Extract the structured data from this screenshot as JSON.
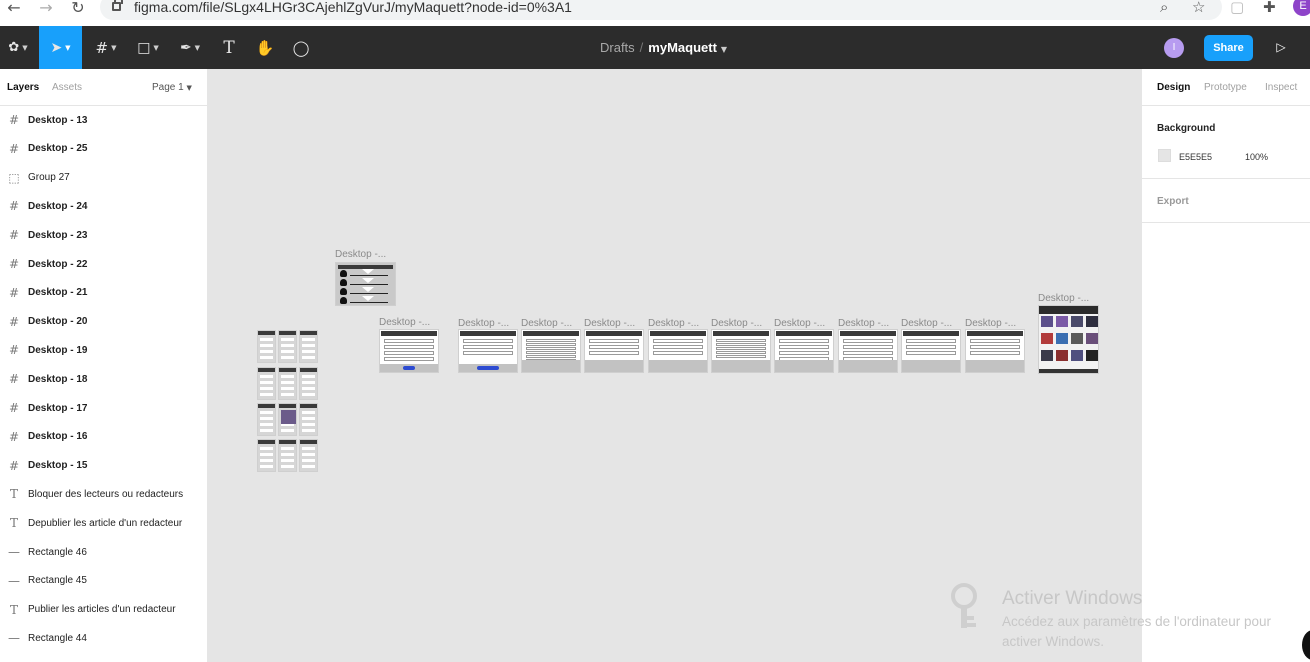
{
  "browser": {
    "url": "figma.com/file/SLgx4LHGr3CAjehlZgVurJ/myMaquett?node-id=0%3A1",
    "profile_initial": "E"
  },
  "toolbar": {
    "breadcrumb_parent": "Drafts",
    "breadcrumb_sep": "/",
    "file_name": "myMaquett",
    "user_initial": "I",
    "share_label": "Share"
  },
  "left_panel": {
    "tab_layers": "Layers",
    "tab_assets": "Assets",
    "page": "Page 1",
    "layers": [
      {
        "name": "Desktop - 13",
        "type": "frame"
      },
      {
        "name": "Desktop - 25",
        "type": "frame"
      },
      {
        "name": "Group 27",
        "type": "group"
      },
      {
        "name": "Desktop - 24",
        "type": "frame"
      },
      {
        "name": "Desktop - 23",
        "type": "frame"
      },
      {
        "name": "Desktop - 22",
        "type": "frame"
      },
      {
        "name": "Desktop - 21",
        "type": "frame"
      },
      {
        "name": "Desktop - 20",
        "type": "frame"
      },
      {
        "name": "Desktop - 19",
        "type": "frame"
      },
      {
        "name": "Desktop - 18",
        "type": "frame"
      },
      {
        "name": "Desktop - 17",
        "type": "frame"
      },
      {
        "name": "Desktop - 16",
        "type": "frame"
      },
      {
        "name": "Desktop - 15",
        "type": "frame"
      },
      {
        "name": "Bloquer des lecteurs ou redacteurs",
        "type": "text"
      },
      {
        "name": "Depublier les article d'un redacteur",
        "type": "text"
      },
      {
        "name": "Rectangle 46",
        "type": "rect"
      },
      {
        "name": "Rectangle 45",
        "type": "rect"
      },
      {
        "name": "Publier les articles d'un redacteur",
        "type": "text"
      },
      {
        "name": "Rectangle 44",
        "type": "rect"
      }
    ]
  },
  "right_panel": {
    "tab_design": "Design",
    "tab_prototype": "Prototype",
    "tab_inspect": "Inspect",
    "background_title": "Background",
    "background_hex": "E5E5E5",
    "background_opacity": "100%",
    "export_title": "Export"
  },
  "canvas": {
    "frame_label": "Desktop -...",
    "frame_label_short": "Desktop - ..."
  },
  "watermark": {
    "title": "Activer Windows",
    "line1": "Accédez aux paramètres de l'ordinateur pour",
    "line2": "activer Windows."
  },
  "colors": {
    "accent": "#18a0fb",
    "toolbar": "#2c2c2c",
    "canvas": "#e5e5e5"
  }
}
